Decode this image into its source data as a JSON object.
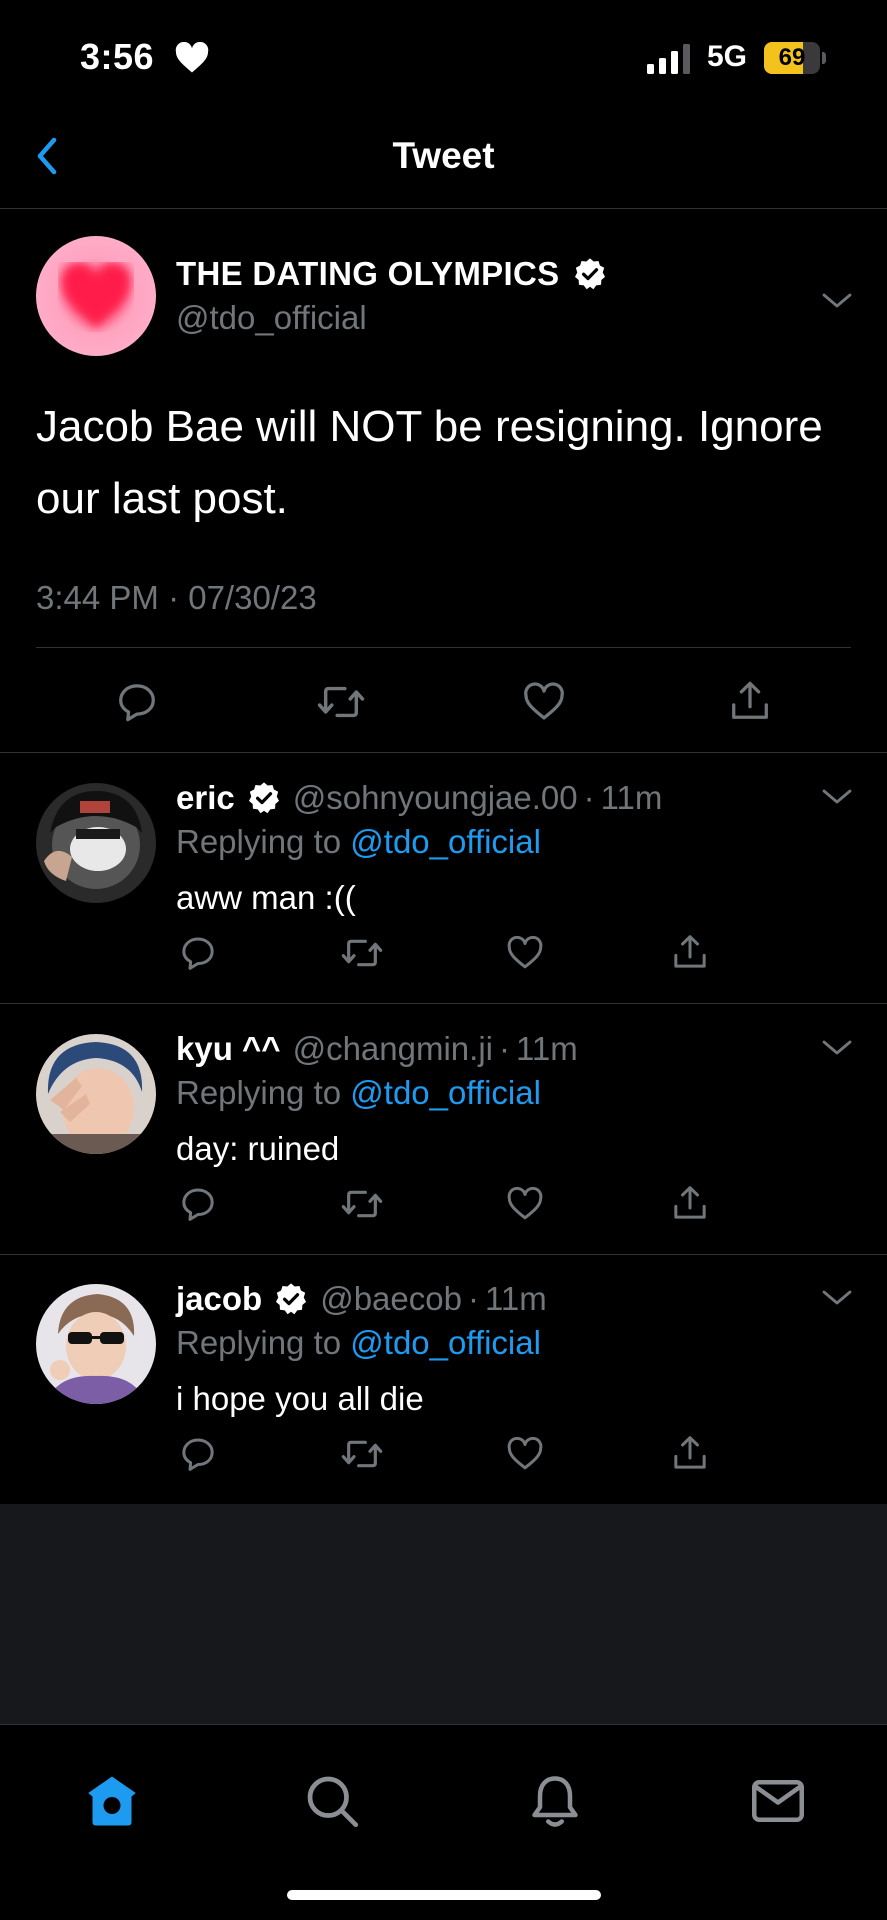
{
  "status_bar": {
    "time": "3:56",
    "network": "5G",
    "battery": "69",
    "battery_level": 0.69
  },
  "header": {
    "title": "Tweet"
  },
  "main_tweet": {
    "name": "THE DATING OLYMPICS",
    "handle": "@tdo_official",
    "text": "Jacob Bae will NOT be resigning. Ignore our last post.",
    "timestamp": "3:44 PM · 07/30/23"
  },
  "replies": [
    {
      "name": "eric",
      "verified": true,
      "handle": "@sohnyoungjae.00",
      "time": "11m",
      "replying_prefix": "Replying to",
      "replying_to": "@tdo_official",
      "text": "aww man :(("
    },
    {
      "name": "kyu ^^",
      "verified": false,
      "handle": "@changmin.ji",
      "time": "11m",
      "replying_prefix": "Replying to",
      "replying_to": "@tdo_official",
      "text": "day: ruined"
    },
    {
      "name": "jacob",
      "verified": true,
      "handle": "@baecob",
      "time": "11m",
      "replying_prefix": "Replying to",
      "replying_to": "@tdo_official",
      "text": "i hope you all die"
    }
  ],
  "tab_bar": {
    "items": [
      "home-icon",
      "search-icon",
      "notifications-icon",
      "messages-icon"
    ],
    "active": "home-icon"
  },
  "colors": {
    "accent": "#1d9bf0",
    "secondary_text": "#71767b",
    "divider": "#2f3336",
    "battery_fill": "#f4c21c"
  }
}
